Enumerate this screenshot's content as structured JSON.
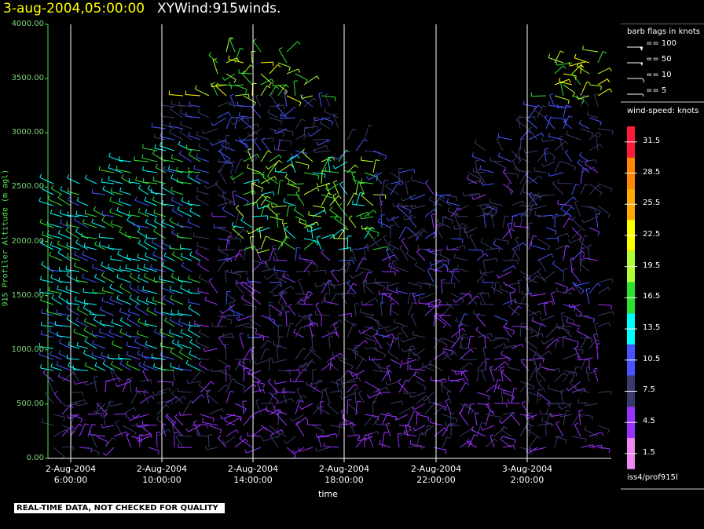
{
  "header": {
    "datetime": "3-aug-2004,05:00:00",
    "product": "XYWind:915winds."
  },
  "chart_data": {
    "type": "wind-barb time-height",
    "ylabel": "915 Profiler Altitude (m agl)",
    "xlabel": "time",
    "ylim": [
      0,
      4000
    ],
    "yticks": [
      "0.00",
      "500.00",
      "1000.00",
      "1500.00",
      "2000.00",
      "2500.00",
      "3000.00",
      "3500.00",
      "4000.00"
    ],
    "xticks": [
      {
        "date": "2-Aug-2004",
        "time": "6:00:00"
      },
      {
        "date": "2-Aug-2004",
        "time": "10:00:00"
      },
      {
        "date": "2-Aug-2004",
        "time": "14:00:00"
      },
      {
        "date": "2-Aug-2004",
        "time": "18:00:00"
      },
      {
        "date": "2-Aug-2004",
        "time": "22:00:00"
      },
      {
        "date": "3-Aug-2004",
        "time": "2:00:00"
      }
    ],
    "vertical_gridlines": true,
    "legend_position": "right",
    "barb_flags": {
      "title": "barb flags in knots",
      "items": [
        "== 100",
        "== 50",
        "== 10",
        "== 5"
      ]
    },
    "speed_scale": {
      "title": "wind-speed: knots",
      "levels": [
        {
          "label": "31.5",
          "color": "#ff1a3c"
        },
        {
          "label": "28.5",
          "color": "#ff8800"
        },
        {
          "label": "25.5",
          "color": "#ffaa00"
        },
        {
          "label": "22.5",
          "color": "#ffff00"
        },
        {
          "label": "19.5",
          "color": "#b0ff30"
        },
        {
          "label": "16.5",
          "color": "#30e030"
        },
        {
          "label": "13.5",
          "color": "#00ffff"
        },
        {
          "label": "10.5",
          "color": "#4455ff"
        },
        {
          "label": "7.5",
          "color": "#3a3a6a"
        },
        {
          "label": "4.5",
          "color": "#9933ff"
        },
        {
          "label": "1.5",
          "color": "#ee88ee"
        }
      ]
    },
    "site": "iss4/prof915l"
  },
  "qc_note": "REAL-TIME DATA, NOT CHECKED FOR QUALITY"
}
